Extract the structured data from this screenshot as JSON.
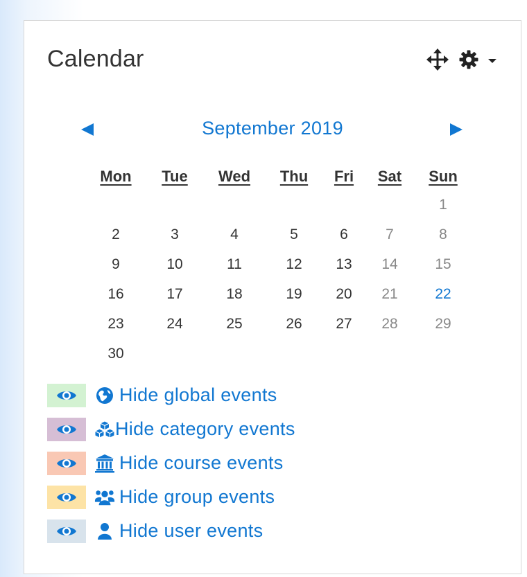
{
  "block": {
    "title": "Calendar"
  },
  "calendar": {
    "month_label": "September 2019",
    "weekdays": [
      "Mon",
      "Tue",
      "Wed",
      "Thu",
      "Fri",
      "Sat",
      "Sun"
    ],
    "weeks": [
      [
        "",
        "",
        "",
        "",
        "",
        "",
        "1"
      ],
      [
        "2",
        "3",
        "4",
        "5",
        "6",
        "7",
        "8"
      ],
      [
        "9",
        "10",
        "11",
        "12",
        "13",
        "14",
        "15"
      ],
      [
        "16",
        "17",
        "18",
        "19",
        "20",
        "21",
        "22"
      ],
      [
        "23",
        "24",
        "25",
        "26",
        "27",
        "28",
        "29"
      ],
      [
        "30",
        "",
        "",
        "",
        "",
        "",
        ""
      ]
    ],
    "today": "22"
  },
  "filters": [
    {
      "label": "Hide global events",
      "icon": "globe-icon",
      "swatch_color": "#d3f2d2"
    },
    {
      "label": "Hide category events",
      "icon": "cubes-icon",
      "swatch_color": "#d6bed5"
    },
    {
      "label": "Hide course events",
      "icon": "university-icon",
      "swatch_color": "#f9c8b4"
    },
    {
      "label": "Hide group events",
      "icon": "users-icon",
      "swatch_color": "#fde3a6"
    },
    {
      "label": "Hide user events",
      "icon": "user-icon",
      "swatch_color": "#d8e3ec"
    }
  ],
  "colors": {
    "link": "#1177d1",
    "text": "#333333",
    "weekend": "#888888"
  }
}
